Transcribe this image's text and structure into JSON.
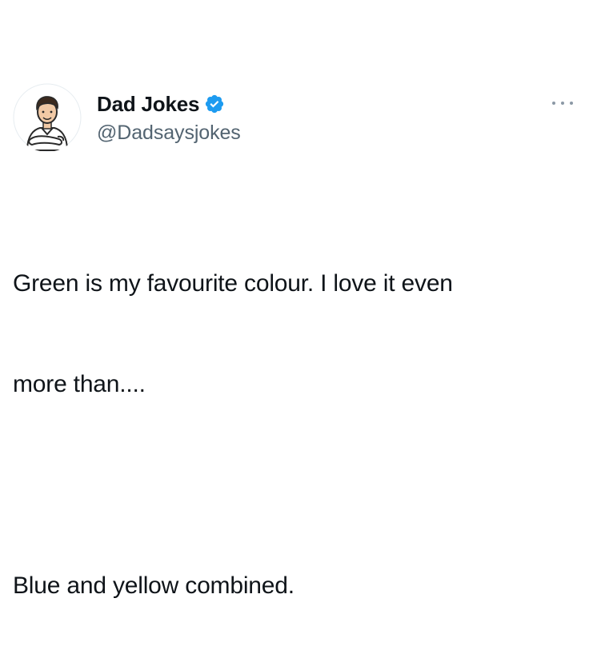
{
  "author": {
    "display_name": "Dad Jokes",
    "handle": "@Dadsaysjokes",
    "verified": true,
    "verified_color": "#1d9bf0",
    "avatar": "cartoon-man-arms-crossed"
  },
  "menu": {
    "icon": "more-options-icon"
  },
  "tweet": {
    "line1": "Green is my favourite colour. I love it even",
    "line2": "more than....",
    "line3": "Blue and yellow combined."
  },
  "colors": {
    "text": "#0f1419",
    "secondary": "#536471",
    "background": "#ffffff"
  }
}
